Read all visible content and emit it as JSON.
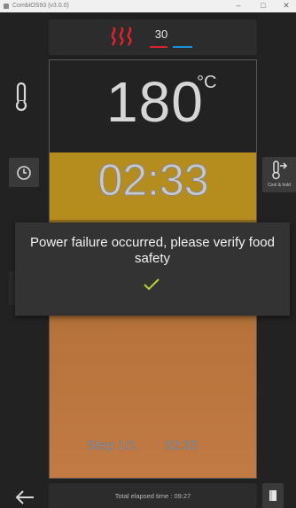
{
  "window": {
    "title": "CombiOS93 (v3.0.0)",
    "minimize_glyph": "–",
    "maximize_glyph": "□",
    "close_glyph": "✕"
  },
  "mode": {
    "icon": "convection-heat-icon",
    "value": "30",
    "accent_colors": {
      "heat": "#d9232d",
      "cool": "#1a8fd6"
    }
  },
  "oven": {
    "temperature": "180",
    "temperature_unit": "°C",
    "timer": "02:33",
    "step_label": "Step 1/1",
    "step_time": "02:33",
    "colors": {
      "timer_band": "#b58c1e",
      "progress": "#c27a44"
    }
  },
  "side_buttons": {
    "temperature_icon": "thermometer-icon",
    "timer_icon": "clock-icon",
    "cook_hold_label": "Cool & hold",
    "cook_hold_icon": "thermometer-arrow-icon"
  },
  "alert": {
    "message": "Power failure occurred, please verify food safety",
    "confirm_icon": "checkmark-icon",
    "confirm_color": "#b6d33a"
  },
  "footer": {
    "back_icon": "back-arrow-icon",
    "elapsed_label": "Total elapsed time : 09:27",
    "book_icon": "book-icon"
  }
}
